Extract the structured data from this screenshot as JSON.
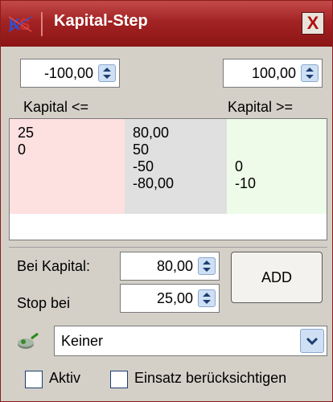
{
  "window": {
    "title": "Kapital-Step",
    "close_label": "X",
    "app_icon": "ks-logo-icon"
  },
  "top": {
    "left_spin_value": "-100,00",
    "right_spin_value": "100,00",
    "label_le": "Kapital <=",
    "label_ge": "Kapital >="
  },
  "grid": {
    "col_le": [
      "25",
      "0"
    ],
    "col_mid": [
      "80,00",
      "50",
      "-50",
      "-80,00"
    ],
    "col_ge": [
      "0",
      "-10"
    ]
  },
  "form": {
    "bei_kapital_label": "Bei Kapital:",
    "bei_kapital_value": "80,00",
    "stop_bei_label": "Stop bei",
    "stop_bei_value": "25,00",
    "add_label": "ADD"
  },
  "combo": {
    "selected": "Keiner",
    "icon": "filter-icon"
  },
  "checkboxes": {
    "aktiv_label": "Aktiv",
    "einsatz_label": "Einsatz berücksichtigen"
  },
  "colors": {
    "titlebar": "#a32323",
    "grid_le_bg": "#fde0e0",
    "grid_mid_bg": "#e0e0e0",
    "grid_ge_bg": "#eefbe8"
  }
}
